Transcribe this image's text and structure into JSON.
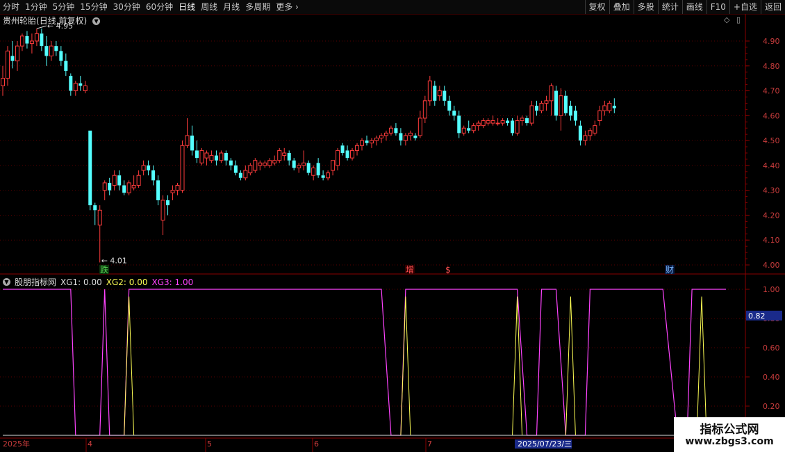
{
  "toolbar": {
    "periods": [
      "分时",
      "1分钟",
      "5分钟",
      "15分钟",
      "30分钟",
      "60分钟",
      "日线",
      "周线",
      "月线",
      "多周期",
      "更多"
    ],
    "active_index": 6,
    "right_buttons": [
      "复权",
      "叠加",
      "多股",
      "统计",
      "画线",
      "F10",
      "+自选",
      "返回"
    ]
  },
  "main_chart": {
    "stock_name": "贵州轮胎",
    "mode": "(日线,前复权)",
    "price_axis": [
      "4.90",
      "4.80",
      "4.70",
      "4.60",
      "4.50",
      "4.40",
      "4.30",
      "4.20",
      "4.10",
      "4.00"
    ],
    "high_annotation": "4.95",
    "low_annotation": "4.01",
    "event_markers": [
      {
        "label": "跌",
        "color": "#55d855",
        "bg": "#0a300a"
      },
      {
        "label": "增",
        "color": "#ff5050",
        "bg": "#300000"
      },
      {
        "label": "$",
        "color": "#ff5050",
        "bg": ""
      },
      {
        "label": "财",
        "color": "#7ab8ff",
        "bg": "#0a1a40"
      }
    ],
    "up_color": "#ff3c3c",
    "down_color": "#54ffff"
  },
  "indicator": {
    "name": "股朋指标网",
    "xg1_label": "XG1: 0.00",
    "xg2_label": "XG2: 0.00",
    "xg3_label": "XG3: 1.00",
    "xg1_color": "#dcdcdc",
    "xg2_color": "#ffff55",
    "xg3_color": "#ff44ff",
    "axis": [
      "1.00",
      "0.80",
      "0.60",
      "0.40",
      "0.20"
    ],
    "cursor_value": "0.82"
  },
  "date_axis": {
    "labels": [
      "2025年",
      "4",
      "5",
      "6",
      "7"
    ],
    "highlight_date": "2025/07/23/三"
  },
  "watermark": {
    "line1": "指标公式网",
    "line2": "www.zbgs3.com"
  },
  "chart_data": {
    "type": "candlestick",
    "ohlc": [
      [
        4.72,
        4.8,
        4.68,
        4.75
      ],
      [
        4.75,
        4.88,
        4.72,
        4.86
      ],
      [
        4.84,
        4.9,
        4.79,
        4.82
      ],
      [
        4.82,
        4.9,
        4.78,
        4.88
      ],
      [
        4.88,
        4.93,
        4.86,
        4.92
      ],
      [
        4.92,
        4.94,
        4.87,
        4.89
      ],
      [
        4.89,
        4.93,
        4.85,
        4.9
      ],
      [
        4.9,
        4.95,
        4.88,
        4.93
      ],
      [
        4.93,
        4.95,
        4.86,
        4.88
      ],
      [
        4.88,
        4.92,
        4.8,
        4.84
      ],
      [
        4.84,
        4.9,
        4.82,
        4.88
      ],
      [
        4.88,
        4.9,
        4.84,
        4.86
      ],
      [
        4.86,
        4.88,
        4.8,
        4.82
      ],
      [
        4.82,
        4.85,
        4.76,
        4.78
      ],
      [
        4.76,
        4.77,
        4.68,
        4.7
      ],
      [
        4.7,
        4.74,
        4.68,
        4.73
      ],
      [
        4.73,
        4.76,
        4.7,
        4.72
      ],
      [
        4.7,
        4.74,
        4.69,
        4.72
      ],
      [
        4.54,
        4.54,
        4.22,
        4.24
      ],
      [
        4.24,
        4.25,
        4.16,
        4.22
      ],
      [
        4.16,
        4.24,
        4.01,
        4.22
      ],
      [
        4.3,
        4.34,
        4.26,
        4.33
      ],
      [
        4.33,
        4.35,
        4.28,
        4.3
      ],
      [
        4.32,
        4.38,
        4.3,
        4.36
      ],
      [
        4.36,
        4.38,
        4.3,
        4.32
      ],
      [
        4.32,
        4.34,
        4.28,
        4.29
      ],
      [
        4.29,
        4.34,
        4.28,
        4.33
      ],
      [
        4.31,
        4.36,
        4.3,
        4.32
      ],
      [
        4.32,
        4.38,
        4.31,
        4.36
      ],
      [
        4.38,
        4.42,
        4.36,
        4.4
      ],
      [
        4.4,
        4.42,
        4.36,
        4.38
      ],
      [
        4.38,
        4.4,
        4.32,
        4.34
      ],
      [
        4.34,
        4.36,
        4.24,
        4.26
      ],
      [
        4.18,
        4.28,
        4.12,
        4.26
      ],
      [
        4.26,
        4.28,
        4.2,
        4.24
      ],
      [
        4.29,
        4.32,
        4.26,
        4.3
      ],
      [
        4.3,
        4.33,
        4.28,
        4.32
      ],
      [
        4.3,
        4.5,
        4.29,
        4.48
      ],
      [
        4.48,
        4.59,
        4.47,
        4.52
      ],
      [
        4.52,
        4.56,
        4.44,
        4.46
      ],
      [
        4.46,
        4.5,
        4.41,
        4.43
      ],
      [
        4.41,
        4.47,
        4.4,
        4.46
      ],
      [
        4.43,
        4.46,
        4.4,
        4.45
      ],
      [
        4.42,
        4.46,
        4.41,
        4.44
      ],
      [
        4.44,
        4.46,
        4.4,
        4.42
      ],
      [
        4.42,
        4.46,
        4.41,
        4.45
      ],
      [
        4.45,
        4.46,
        4.4,
        4.42
      ],
      [
        4.42,
        4.43,
        4.38,
        4.4
      ],
      [
        4.4,
        4.42,
        4.36,
        4.37
      ],
      [
        4.37,
        4.38,
        4.34,
        4.35
      ],
      [
        4.35,
        4.4,
        4.34,
        4.38
      ],
      [
        4.37,
        4.41,
        4.36,
        4.4
      ],
      [
        4.38,
        4.43,
        4.37,
        4.42
      ],
      [
        4.4,
        4.42,
        4.38,
        4.41
      ],
      [
        4.4,
        4.42,
        4.39,
        4.41
      ],
      [
        4.4,
        4.43,
        4.39,
        4.42
      ],
      [
        4.41,
        4.44,
        4.4,
        4.42
      ],
      [
        4.42,
        4.47,
        4.41,
        4.46
      ],
      [
        4.44,
        4.47,
        4.42,
        4.45
      ],
      [
        4.45,
        4.46,
        4.4,
        4.42
      ],
      [
        4.42,
        4.43,
        4.38,
        4.39
      ],
      [
        4.39,
        4.41,
        4.37,
        4.4
      ],
      [
        4.4,
        4.46,
        4.38,
        4.41
      ],
      [
        4.41,
        4.42,
        4.36,
        4.37
      ],
      [
        4.36,
        4.4,
        4.34,
        4.39
      ],
      [
        4.41,
        4.43,
        4.35,
        4.36
      ],
      [
        4.36,
        4.38,
        4.34,
        4.35
      ],
      [
        4.35,
        4.38,
        4.34,
        4.37
      ],
      [
        4.38,
        4.4,
        4.36,
        4.42
      ],
      [
        4.4,
        4.47,
        4.38,
        4.46
      ],
      [
        4.48,
        4.49,
        4.44,
        4.45
      ],
      [
        4.46,
        4.48,
        4.42,
        4.43
      ],
      [
        4.43,
        4.47,
        4.42,
        4.46
      ],
      [
        4.46,
        4.49,
        4.44,
        4.48
      ],
      [
        4.48,
        4.51,
        4.46,
        4.5
      ],
      [
        4.5,
        4.52,
        4.48,
        4.49
      ],
      [
        4.49,
        4.51,
        4.47,
        4.5
      ],
      [
        4.5,
        4.52,
        4.48,
        4.51
      ],
      [
        4.51,
        4.53,
        4.49,
        4.52
      ],
      [
        4.52,
        4.54,
        4.5,
        4.53
      ],
      [
        4.53,
        4.56,
        4.52,
        4.55
      ],
      [
        4.55,
        4.57,
        4.52,
        4.53
      ],
      [
        4.53,
        4.55,
        4.48,
        4.5
      ],
      [
        4.5,
        4.53,
        4.48,
        4.52
      ],
      [
        4.52,
        4.54,
        4.5,
        4.53
      ],
      [
        4.52,
        4.53,
        4.5,
        4.51
      ],
      [
        4.52,
        4.62,
        4.51,
        4.59
      ],
      [
        4.59,
        4.68,
        4.57,
        4.66
      ],
      [
        4.66,
        4.76,
        4.64,
        4.74
      ],
      [
        4.72,
        4.74,
        4.64,
        4.66
      ],
      [
        4.68,
        4.72,
        4.66,
        4.7
      ],
      [
        4.7,
        4.72,
        4.64,
        4.66
      ],
      [
        4.66,
        4.68,
        4.6,
        4.62
      ],
      [
        4.62,
        4.64,
        4.58,
        4.6
      ],
      [
        4.6,
        4.62,
        4.51,
        4.53
      ],
      [
        4.53,
        4.56,
        4.52,
        4.55
      ],
      [
        4.55,
        4.58,
        4.53,
        4.54
      ],
      [
        4.54,
        4.57,
        4.53,
        4.56
      ],
      [
        4.56,
        4.58,
        4.54,
        4.57
      ],
      [
        4.56,
        4.59,
        4.55,
        4.58
      ],
      [
        4.57,
        4.59,
        4.56,
        4.58
      ],
      [
        4.57,
        4.6,
        4.56,
        4.58
      ],
      [
        4.57,
        4.59,
        4.56,
        4.57
      ],
      [
        4.57,
        4.59,
        4.56,
        4.58
      ],
      [
        4.58,
        4.59,
        4.56,
        4.57
      ],
      [
        4.58,
        4.59,
        4.52,
        4.53
      ],
      [
        4.53,
        4.6,
        4.52,
        4.58
      ],
      [
        4.58,
        4.6,
        4.56,
        4.59
      ],
      [
        4.59,
        4.6,
        4.56,
        4.57
      ],
      [
        4.57,
        4.66,
        4.56,
        4.64
      ],
      [
        4.64,
        4.66,
        4.6,
        4.62
      ],
      [
        4.62,
        4.66,
        4.61,
        4.65
      ],
      [
        4.65,
        4.68,
        4.62,
        4.66
      ],
      [
        4.66,
        4.73,
        4.6,
        4.72
      ],
      [
        4.7,
        4.72,
        4.58,
        4.6
      ],
      [
        4.6,
        4.71,
        4.54,
        4.68
      ],
      [
        4.68,
        4.7,
        4.6,
        4.61
      ],
      [
        4.64,
        4.66,
        4.58,
        4.6
      ],
      [
        4.62,
        4.64,
        4.56,
        4.58
      ],
      [
        4.56,
        4.58,
        4.48,
        4.5
      ],
      [
        4.5,
        4.54,
        4.48,
        4.52
      ],
      [
        4.52,
        4.55,
        4.5,
        4.54
      ],
      [
        4.53,
        4.58,
        4.52,
        4.56
      ],
      [
        4.58,
        4.64,
        4.56,
        4.62
      ],
      [
        4.62,
        4.66,
        4.6,
        4.64
      ],
      [
        4.62,
        4.66,
        4.61,
        4.65
      ],
      [
        4.64,
        4.67,
        4.61,
        4.63
      ]
    ],
    "xg3_switches": [
      [
        0,
        1
      ],
      [
        14,
        1
      ],
      [
        15,
        0
      ],
      [
        20,
        0
      ],
      [
        21,
        1
      ],
      [
        22,
        0
      ],
      [
        25,
        0
      ],
      [
        26,
        1
      ],
      [
        78,
        1
      ],
      [
        80,
        0
      ],
      [
        82,
        0
      ],
      [
        83,
        1
      ],
      [
        106,
        1
      ],
      [
        108,
        0
      ],
      [
        110,
        0
      ],
      [
        111,
        1
      ],
      [
        114,
        1
      ],
      [
        116,
        0
      ],
      [
        120,
        0
      ],
      [
        121,
        1
      ],
      [
        136,
        1
      ],
      [
        139,
        0
      ],
      [
        141,
        0
      ],
      [
        142,
        1
      ],
      [
        149,
        1
      ]
    ],
    "xg2_spikes": [
      26,
      83,
      106,
      117,
      144
    ],
    "total_bars": 150,
    "y_range": [
      3.98,
      4.98
    ]
  }
}
